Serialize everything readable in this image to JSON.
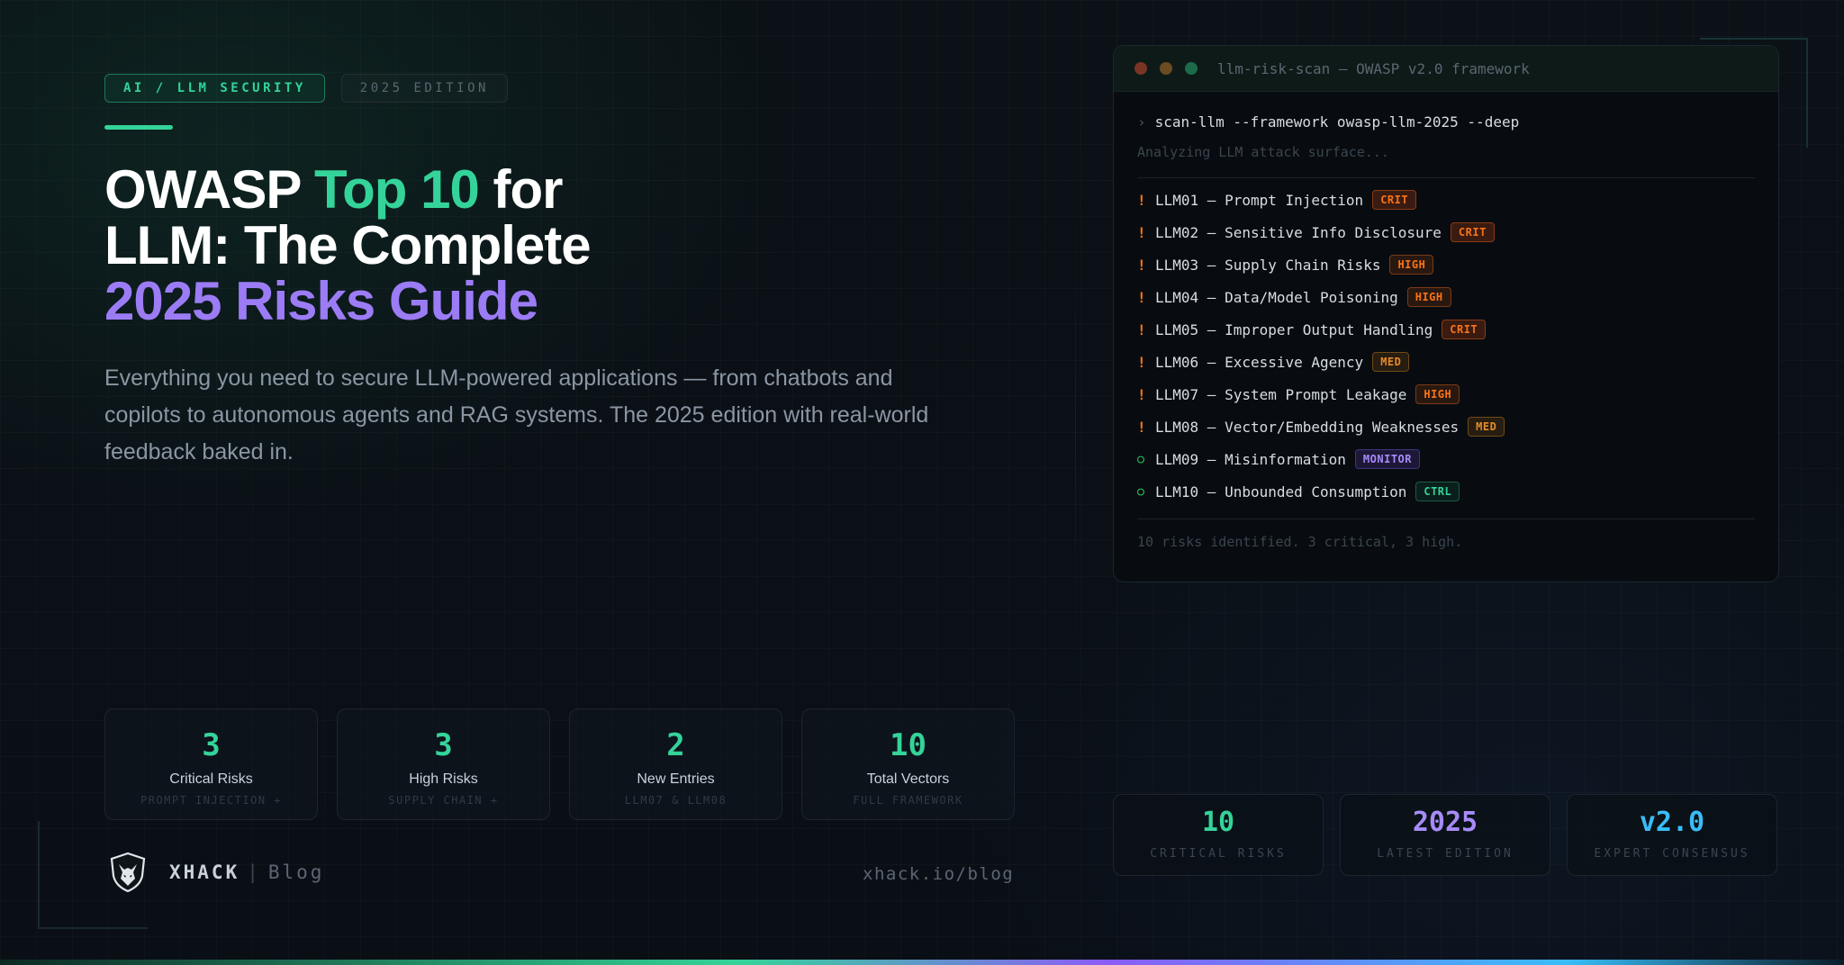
{
  "tags": {
    "category": "AI / LLM SECURITY",
    "edition": "2025 EDITION"
  },
  "headline": {
    "part1": "OWASP ",
    "part2_green": "Top 10",
    "part3": " for",
    "line2": "LLM: The Complete",
    "line3_purple": "2025 Risks Guide"
  },
  "subtitle": "Everything you need to secure LLM-powered applications — from chatbots and copilots to autonomous agents and RAG systems. The 2025 edition with real-world feedback baked in.",
  "stats": [
    {
      "value": "3",
      "label": "Critical Risks",
      "sub": "PROMPT INJECTION +"
    },
    {
      "value": "3",
      "label": "High Risks",
      "sub": "SUPPLY CHAIN +"
    },
    {
      "value": "2",
      "label": "New Entries",
      "sub": "LLM07 & LLM08"
    },
    {
      "value": "10",
      "label": "Total Vectors",
      "sub": "FULL FRAMEWORK"
    }
  ],
  "brand": {
    "name": "XHACK",
    "separator": "|",
    "section": "Blog",
    "url": "xhack.io/blog"
  },
  "terminal": {
    "title": "llm-risk-scan — OWASP v2.0 framework",
    "prompt": "›",
    "command": "scan-llm --framework owasp-llm-2025 --deep",
    "status": "Analyzing LLM attack surface...",
    "risks": [
      {
        "marker": "!",
        "text": "LLM01 — Prompt Injection",
        "badge": "CRIT"
      },
      {
        "marker": "!",
        "text": "LLM02 — Sensitive Info Disclosure",
        "badge": "CRIT"
      },
      {
        "marker": "!",
        "text": "LLM03 — Supply Chain Risks",
        "badge": "HIGH"
      },
      {
        "marker": "!",
        "text": "LLM04 — Data/Model Poisoning",
        "badge": "HIGH"
      },
      {
        "marker": "!",
        "text": "LLM05 — Improper Output Handling",
        "badge": "CRIT"
      },
      {
        "marker": "!",
        "text": "LLM06 — Excessive Agency",
        "badge": "MED"
      },
      {
        "marker": "!",
        "text": "LLM07 — System Prompt Leakage",
        "badge": "HIGH"
      },
      {
        "marker": "!",
        "text": "LLM08 — Vector/Embedding Weaknesses",
        "badge": "MED"
      },
      {
        "marker": "○",
        "text": "LLM09 — Misinformation",
        "badge": "MONITOR"
      },
      {
        "marker": "○",
        "text": "LLM10 — Unbounded Consumption",
        "badge": "CTRL"
      }
    ],
    "summary": "10 risks identified. 3 critical, 3 high."
  },
  "right_stats": [
    {
      "value": "10",
      "label": "CRITICAL RISKS",
      "color": "#34d399"
    },
    {
      "value": "2025",
      "label": "LATEST EDITION",
      "color": "#a78bfa"
    },
    {
      "value": "v2.0",
      "label": "EXPERT CONSENSUS",
      "color": "#38bdf8"
    }
  ],
  "colors": {
    "green": "#34d399",
    "purple": "#9b7cf5",
    "orange": "#f97316",
    "blue": "#38bdf8"
  }
}
